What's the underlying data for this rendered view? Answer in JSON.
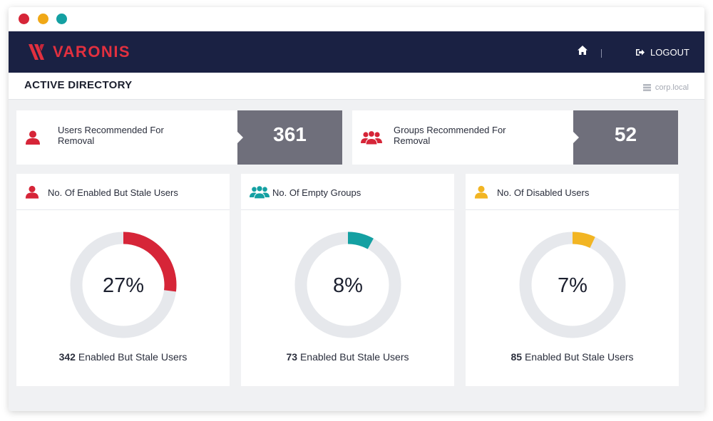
{
  "window": {
    "controls": [
      "close",
      "minimize",
      "maximize"
    ]
  },
  "navbar": {
    "logo_text": "VARONIS",
    "logout_label": "LOGOUT",
    "home_icon": "home-icon",
    "logout_icon": "logout-icon"
  },
  "header": {
    "title": "ACTIVE DIRECTORY",
    "domain": "corp.local",
    "domain_icon": "server-icon"
  },
  "recommendations": [
    {
      "label": "Users Recommended For Removal",
      "value": "361",
      "icon": "user-icon",
      "color": "#d62538"
    },
    {
      "label": "Groups Recommended For Removal",
      "value": "52",
      "icon": "group-icon",
      "color": "#d62538"
    }
  ],
  "stats": [
    {
      "title": "No. Of Enabled But Stale Users",
      "percent_label": "27%",
      "percent": 27,
      "count": "342",
      "count_label": "Enabled But Stale Users",
      "icon": "user-icon",
      "color": "#d62538"
    },
    {
      "title": "No. Of Empty Groups",
      "percent_label": "8%",
      "percent": 8,
      "count": "73",
      "count_label": "Enabled But Stale Users",
      "icon": "group-icon",
      "color": "#14a0a2"
    },
    {
      "title": "No. Of Disabled Users",
      "percent_label": "7%",
      "percent": 7,
      "count": "85",
      "count_label": "Enabled But Stale Users",
      "icon": "user-icon",
      "color": "#f2b523"
    }
  ],
  "colors": {
    "navbar": "#1a2143",
    "accent_red": "#d62538",
    "value_box": "#6f6f7b",
    "donut_track": "#e6e8ec"
  }
}
